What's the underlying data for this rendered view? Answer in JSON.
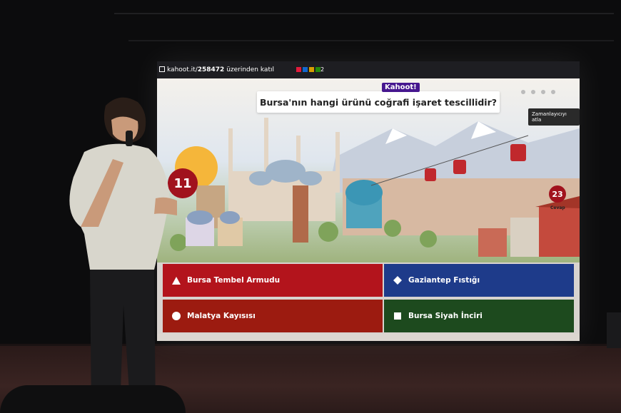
{
  "screen": {
    "join_prefix": "kahoot.it/",
    "join_pin": "258472",
    "join_suffix": " üzerinden katıl",
    "player_count": "2",
    "logo": "Kahoot!",
    "question": "Bursa'nın hangi ürünü coğrafi işaret tescillidir?",
    "skip_label": "Zamanlayıcıyı atla",
    "timer": "11",
    "answers_count": "23",
    "answers_label": "Cevap",
    "answers": [
      {
        "label": "Bursa Tembel Armudu",
        "shape": "triangle-icon",
        "color": "#b3141c"
      },
      {
        "label": "Gaziantep Fıstığı",
        "shape": "diamond-icon",
        "color": "#1e3b8a"
      },
      {
        "label": "Malatya Kayısısı",
        "shape": "circle-icon",
        "color": "#9c1b10"
      },
      {
        "label": "Bursa Siyah İnciri",
        "shape": "square-icon",
        "color": "#1d4a1e"
      }
    ]
  }
}
